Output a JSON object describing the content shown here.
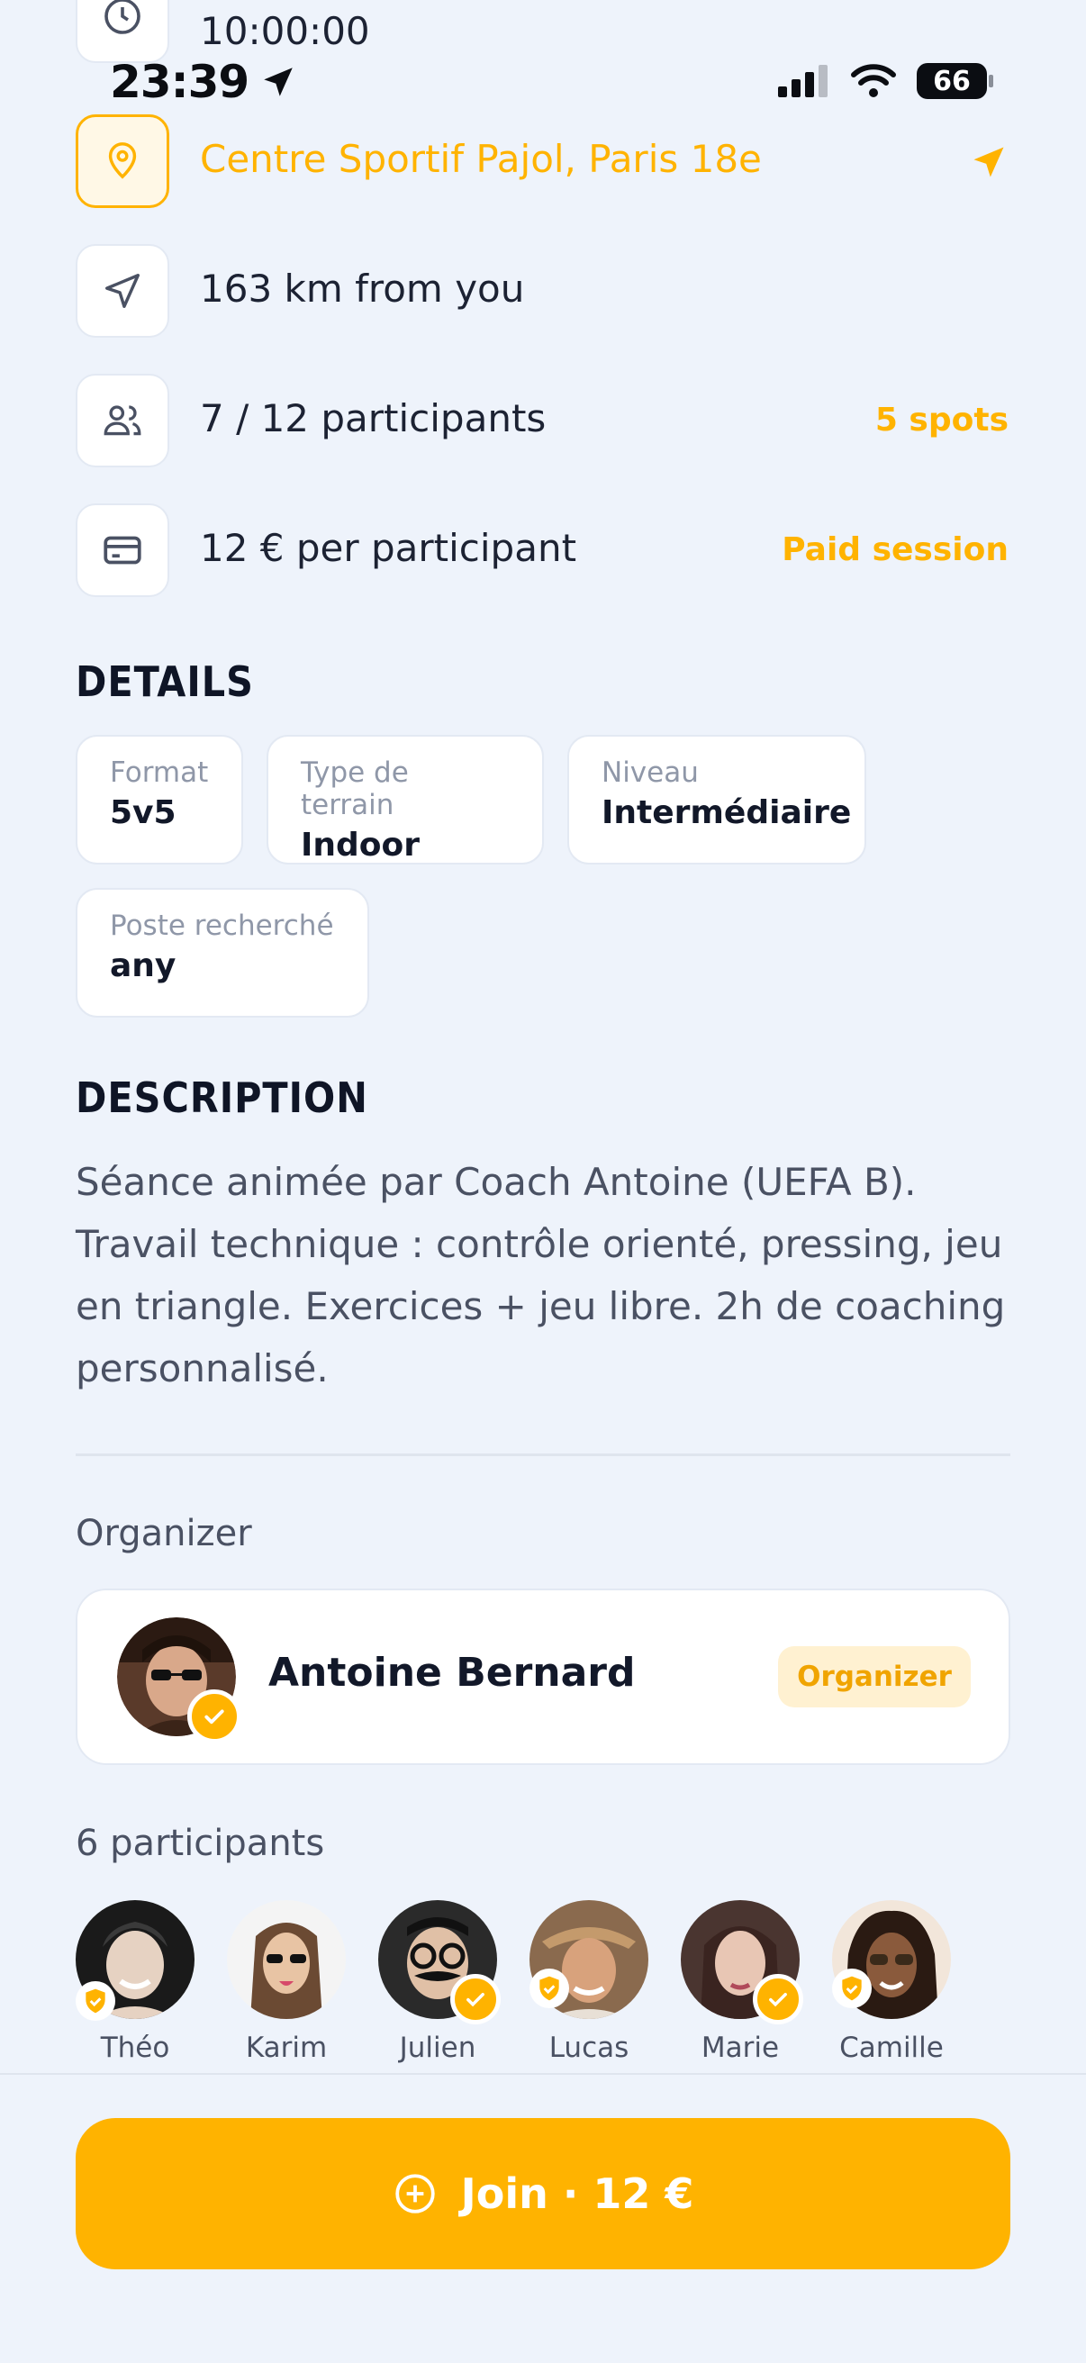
{
  "status_bar": {
    "time": "23:39",
    "battery": "66"
  },
  "session": {
    "start_time": "10:00:00",
    "location": "Centre Sportif Pajol, Paris 18e",
    "distance": "163 km from you",
    "participants_count": "7 / 12 participants",
    "spots_left": "5 spots",
    "price": "12 € per participant",
    "price_tag": "Paid session"
  },
  "details": {
    "title": "DETAILS",
    "chips": [
      {
        "label": "Format",
        "value": "5v5"
      },
      {
        "label": "Type de terrain",
        "value": "Indoor"
      },
      {
        "label": "Niveau",
        "value": "Intermédiaire"
      },
      {
        "label": "Poste recherché",
        "value": "any"
      }
    ]
  },
  "description": {
    "title": "DESCRIPTION",
    "text": "Séance animée par Coach Antoine (UEFA B). Travail technique : contrôle orienté, pressing, jeu en triangle. Exercices + jeu libre. 2h de coaching personnalisé."
  },
  "organizer": {
    "section_label": "Organizer",
    "name": "Antoine Bernard",
    "badge": "Organizer"
  },
  "participants": {
    "section_label": "6 participants",
    "list": [
      {
        "name": "Théo"
      },
      {
        "name": "Karim"
      },
      {
        "name": "Julien"
      },
      {
        "name": "Lucas"
      },
      {
        "name": "Marie"
      },
      {
        "name": "Camille"
      }
    ]
  },
  "join_button": {
    "label": "Join · 12 €"
  },
  "colors": {
    "accent": "#ffb300",
    "background": "#eef3fb"
  }
}
